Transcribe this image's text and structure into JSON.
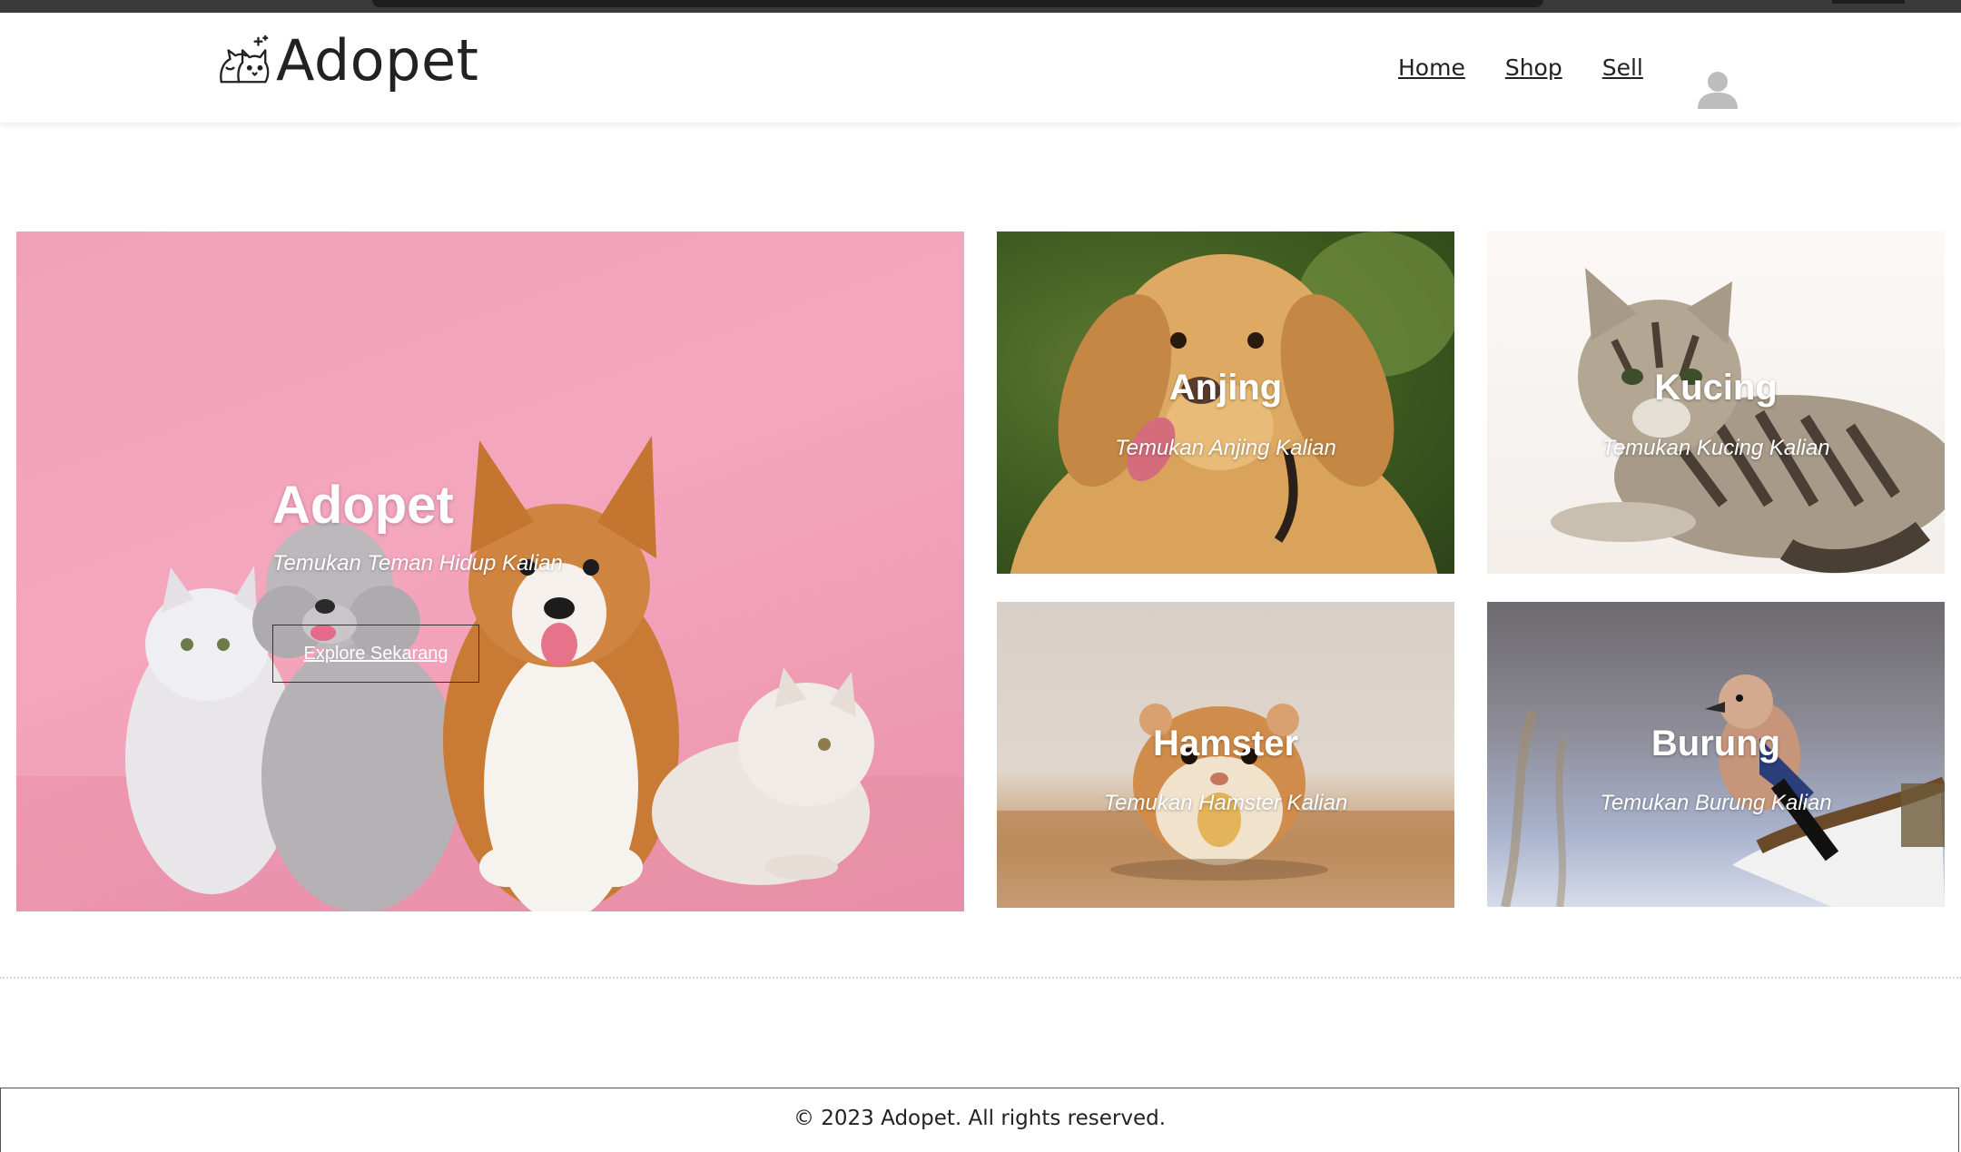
{
  "brand": {
    "name": "Adopet",
    "logo_icon": "cat-dog-logo-icon"
  },
  "nav": {
    "items": [
      {
        "label": "Home"
      },
      {
        "label": "Shop"
      },
      {
        "label": "Sell"
      }
    ],
    "profile_icon": "user-avatar-icon"
  },
  "hero": {
    "title": "Adopet",
    "subtitle": "Temukan Teman Hidup Kalian",
    "button_label": "Explore Sekarang",
    "background_color": "#f4a6bd"
  },
  "categories": [
    {
      "title": "Anjing",
      "subtitle": "Temukan Anjing Kalian"
    },
    {
      "title": "Kucing",
      "subtitle": "Temukan Kucing Kalian"
    },
    {
      "title": "Hamster",
      "subtitle": "Temukan Hamster Kalian"
    },
    {
      "title": "Burung",
      "subtitle": "Temukan Burung Kalian"
    }
  ],
  "footer": {
    "text": "© 2023 Adopet. All rights reserved."
  }
}
